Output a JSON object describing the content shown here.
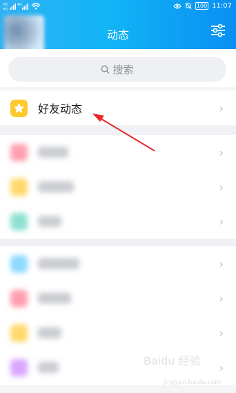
{
  "status_bar": {
    "left_text": "HD ᵢₗₗ ⁴⁶ᵢₗₗ",
    "battery": "100",
    "time": "11:07"
  },
  "header": {
    "title": "动态"
  },
  "search": {
    "placeholder": "搜索"
  },
  "friend_feed": {
    "label": "好友动态",
    "icon_color": "#ffc92e"
  },
  "group1_icons": [
    "#ff9fb0",
    "#ffd86a",
    "#8fe0d2"
  ],
  "group2_icons": [
    "#8dd8ff",
    "#ff9fb0",
    "#ffd86a",
    "#d9a6ff"
  ],
  "accent": "#12b5f6",
  "annotation_color": "#e8292a",
  "watermark": {
    "brand": "Baidu 经验",
    "url": "jingyan.baidu.com"
  }
}
